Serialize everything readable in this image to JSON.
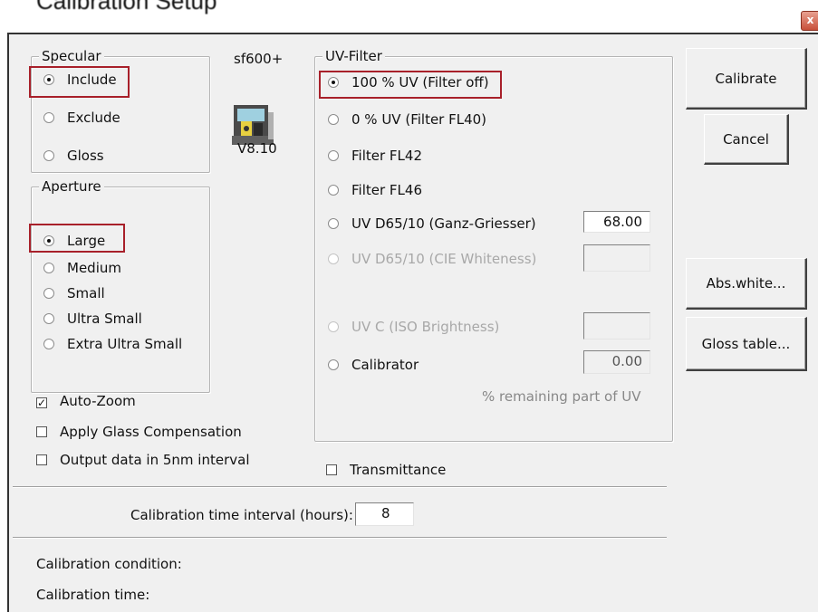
{
  "window": {
    "title": "Calibration Setup",
    "close_glyph": "x"
  },
  "specular": {
    "title": "Specular",
    "options": [
      "Include",
      "Exclude",
      "Gloss"
    ],
    "selected": "Include"
  },
  "instrument": {
    "model": "sf600+",
    "version": "V8.10"
  },
  "aperture": {
    "title": "Aperture",
    "options": [
      "Large",
      "Medium",
      "Small",
      "Ultra Small",
      "Extra Ultra Small"
    ],
    "selected": "Large"
  },
  "options": {
    "auto_zoom": {
      "label": "Auto-Zoom",
      "checked": true
    },
    "glass_comp": {
      "label": "Apply Glass Compensation",
      "checked": false
    },
    "output_5nm": {
      "label": "Output data in 5nm interval",
      "checked": false
    },
    "transmittance": {
      "label": "Transmittance",
      "checked": false
    }
  },
  "uv_filter": {
    "title": "UV-Filter",
    "options": [
      {
        "label": "100 % UV (Filter off)",
        "selected": true,
        "enabled": true,
        "value": null
      },
      {
        "label": "0 %  UV (Filter FL40)",
        "selected": false,
        "enabled": true,
        "value": null
      },
      {
        "label": "Filter FL42",
        "selected": false,
        "enabled": true,
        "value": null
      },
      {
        "label": "Filter FL46",
        "selected": false,
        "enabled": true,
        "value": null
      },
      {
        "label": "UV D65/10 (Ganz-Griesser)",
        "selected": false,
        "enabled": true,
        "value": "68.00"
      },
      {
        "label": "UV D65/10 (CIE Whiteness)",
        "selected": false,
        "enabled": false,
        "value": ""
      },
      {
        "label": "UV C (ISO Brightness)",
        "selected": false,
        "enabled": false,
        "value": ""
      },
      {
        "label": "Calibrator",
        "selected": false,
        "enabled": true,
        "value": "0.00"
      }
    ],
    "note": "% remaining part of UV"
  },
  "buttons": {
    "calibrate": "Calibrate",
    "cancel": "Cancel",
    "abs_white": "Abs.white...",
    "gloss_table": "Gloss table..."
  },
  "interval": {
    "label": "Calibration time interval (hours):",
    "value": "8"
  },
  "status": {
    "condition_label": "Calibration condition:",
    "time_label": "Calibration time:"
  },
  "colors": {
    "highlight_box": "#a8202a",
    "dialog_bg": "#f0f0f0"
  }
}
